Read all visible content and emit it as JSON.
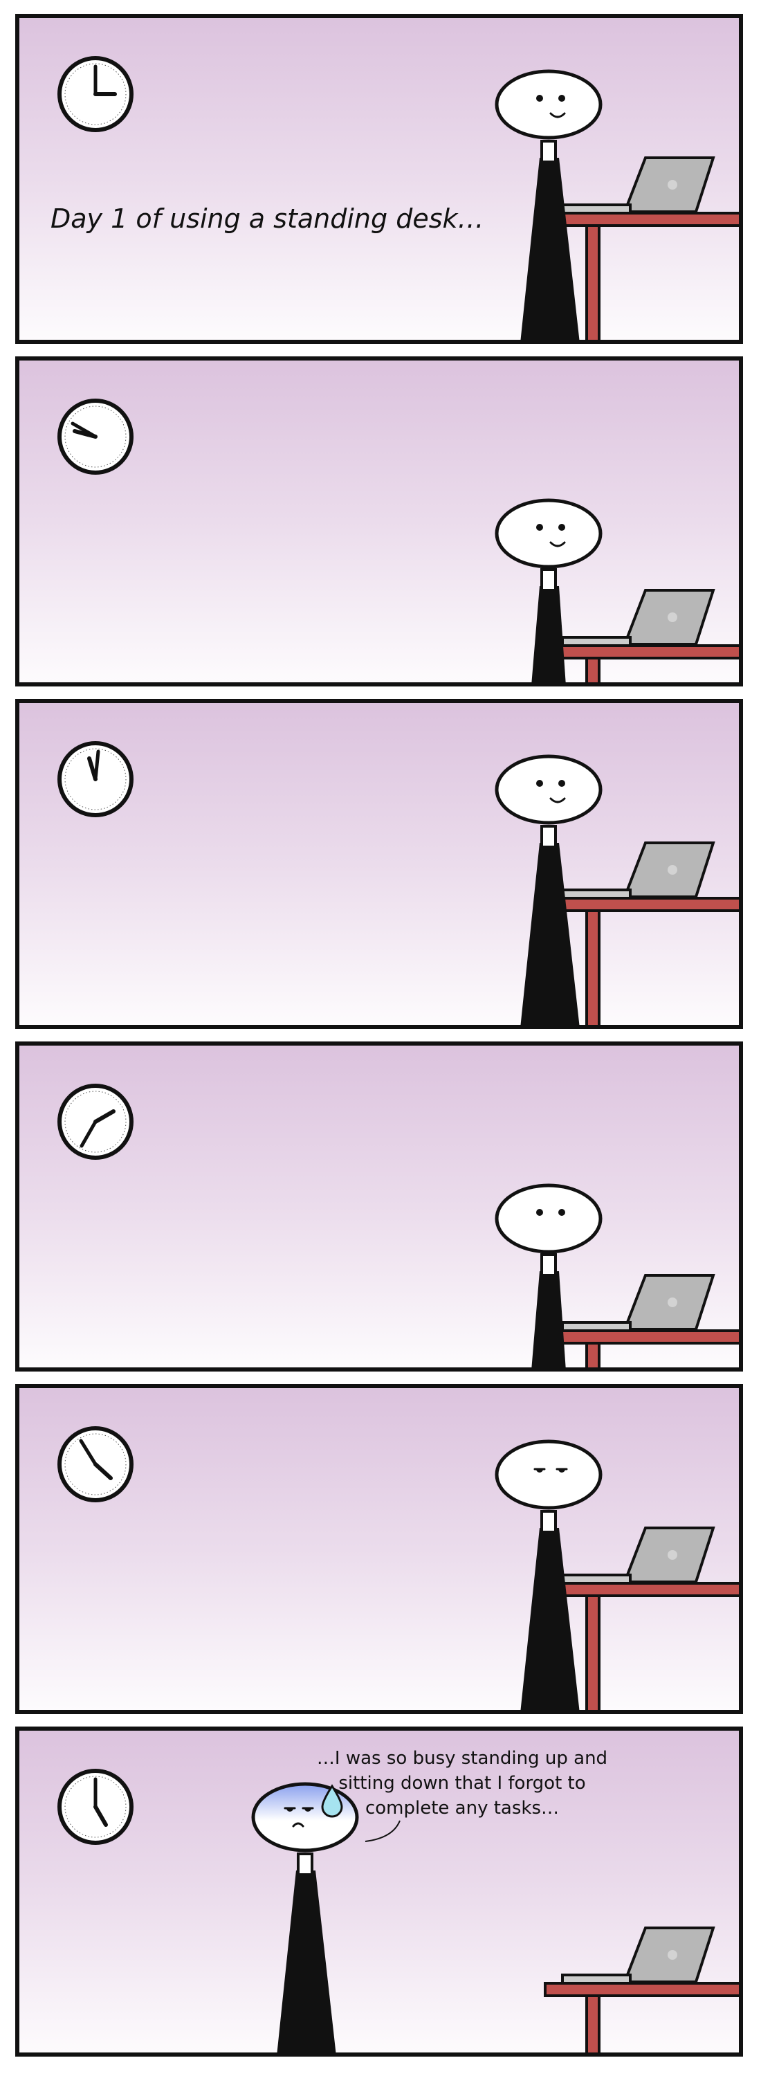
{
  "comic": {
    "caption_panel1": "Day 1 of using a standing desk…",
    "speech_panel6": "…I was so busy standing up and sitting down that I forgot to complete any tasks…"
  },
  "panels": [
    {
      "hour": 3,
      "minute": 0,
      "pose": "standing",
      "expression": "smile"
    },
    {
      "hour": 9,
      "minute": 50,
      "pose": "sitting",
      "expression": "smile"
    },
    {
      "hour": 11,
      "minute": 0,
      "pose": "standing",
      "expression": "smile"
    },
    {
      "hour": 2,
      "minute": 35,
      "pose": "sitting",
      "expression": "neutral"
    },
    {
      "hour": 4,
      "minute": 50,
      "pose": "standing",
      "expression": "tired"
    },
    {
      "hour": 5,
      "minute": 0,
      "pose": "standing",
      "expression": "worried"
    }
  ],
  "colors": {
    "bg_top": "#dcc3de",
    "bg_bottom": "#fdfbfd",
    "desk": "#c0504d",
    "laptop": "#b7b7b7",
    "body": "#111111",
    "sweat": "#a6e3f0"
  }
}
